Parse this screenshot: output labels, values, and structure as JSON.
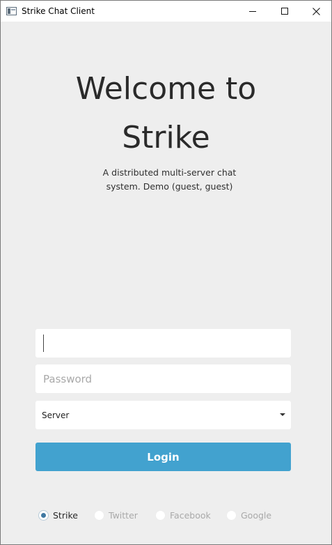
{
  "window": {
    "title": "Strike Chat Client",
    "controls": [
      "minimize",
      "maximize",
      "close"
    ]
  },
  "welcome": {
    "line1": "Welcome to",
    "line2": "Strike",
    "subtitle_line1": "A distributed multi-server chat",
    "subtitle_line2": "system. Demo (guest, guest)"
  },
  "form": {
    "username": {
      "value": "",
      "placeholder": ""
    },
    "password": {
      "value": "",
      "placeholder": "Password"
    },
    "server": {
      "selected": "Server"
    },
    "login_label": "Login"
  },
  "providers": {
    "selected": "Strike",
    "items": [
      {
        "label": "Strike",
        "selected": true
      },
      {
        "label": "Twitter",
        "selected": false
      },
      {
        "label": "Facebook",
        "selected": false
      },
      {
        "label": "Google",
        "selected": false
      }
    ]
  },
  "colors": {
    "accent": "#42a2cf",
    "background": "#eeeeee",
    "radio_dot": "#3f78a2"
  }
}
